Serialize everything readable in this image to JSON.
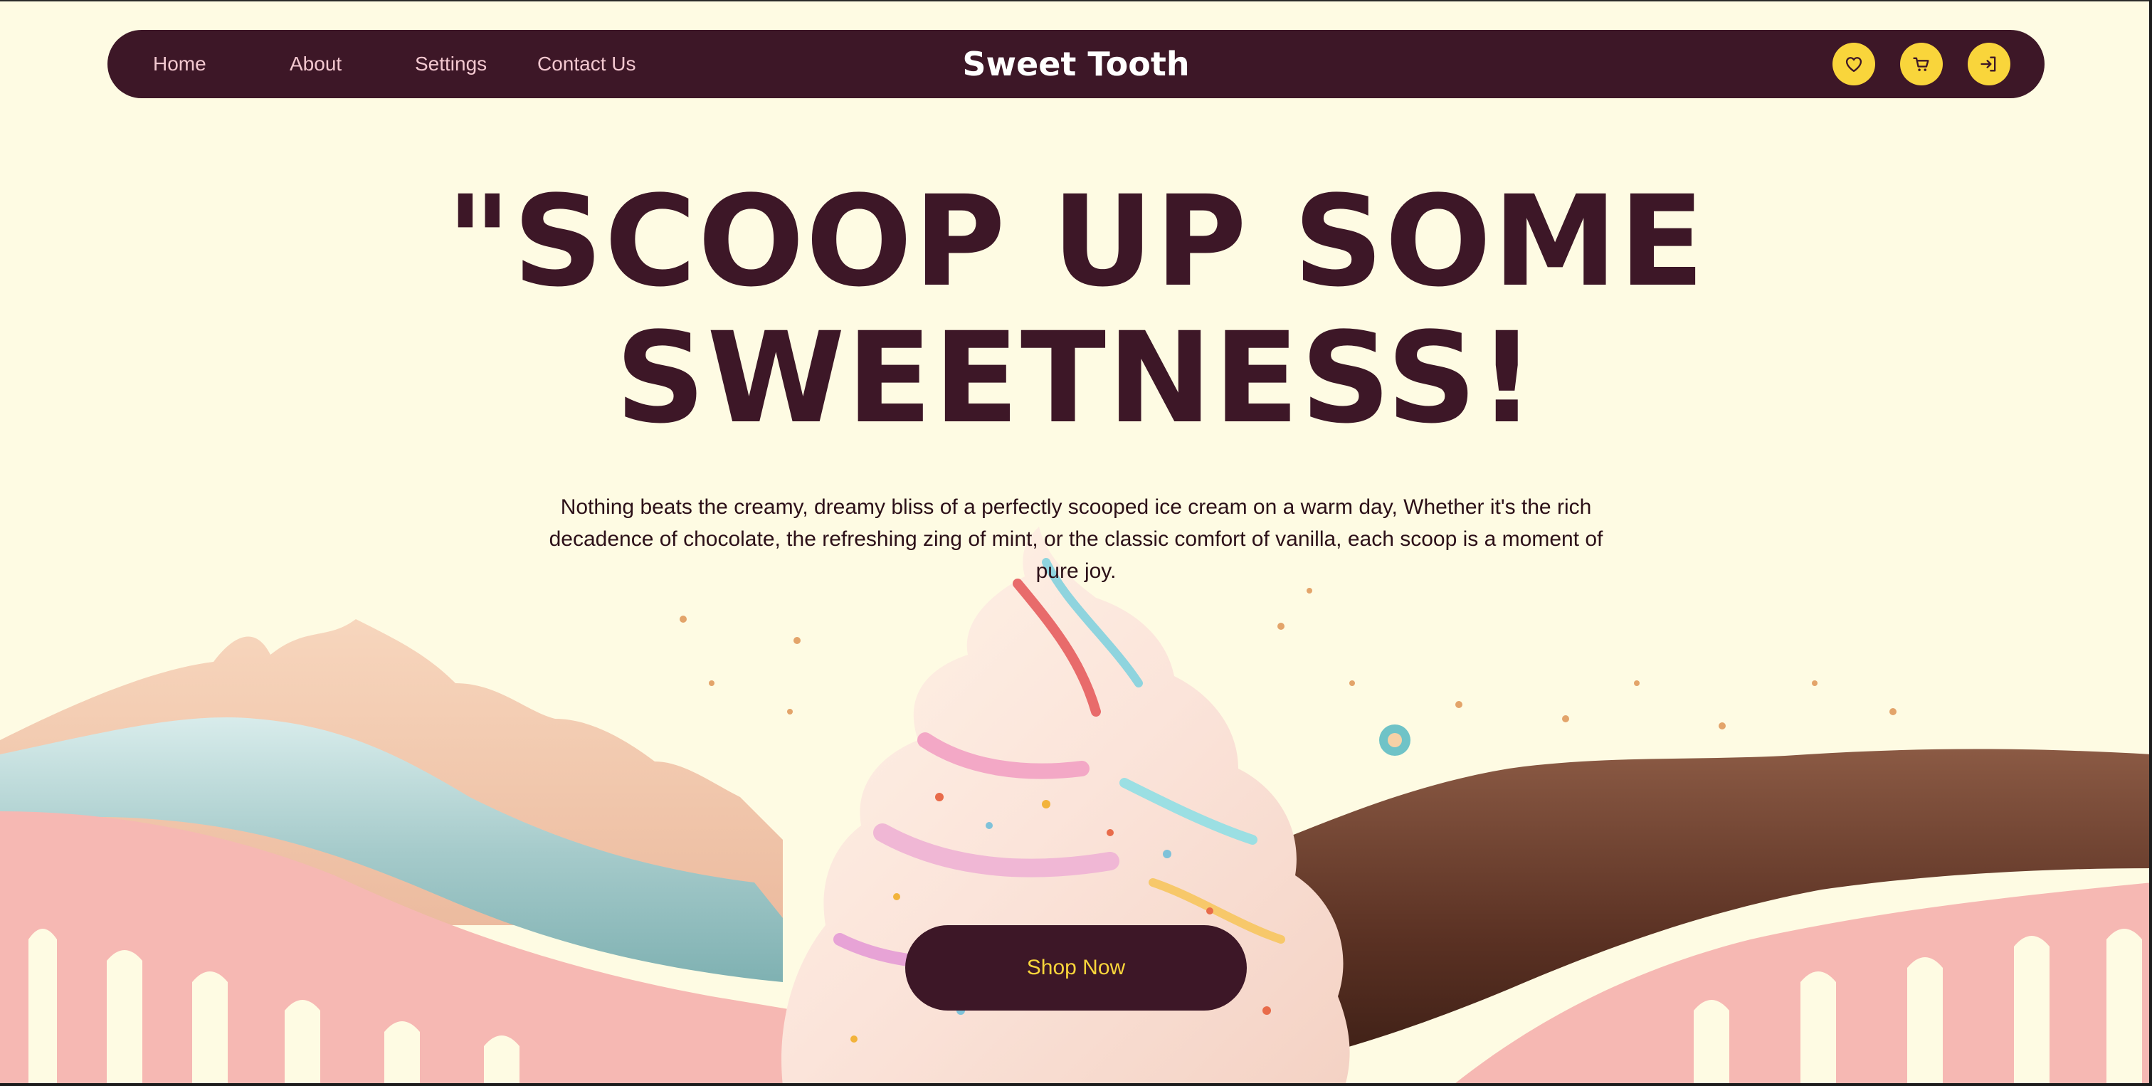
{
  "nav": {
    "links": [
      "Home",
      "About",
      "Settings",
      "Contact Us"
    ],
    "brand": "Sweet Tooth",
    "icons": [
      "heart-icon",
      "cart-icon",
      "sign-in-icon"
    ]
  },
  "hero": {
    "title_line1": "\"SCOOP UP SOME",
    "title_line2": "SWEETNESS!",
    "description": "Nothing beats the creamy, dreamy bliss of a perfectly scooped ice cream on a warm day, Whether it's the rich decadence of chocolate, the refreshing zing of mint, or the classic comfort of vanilla, each scoop is a moment of pure joy.",
    "cta_label": "Shop Now"
  },
  "colors": {
    "background": "#fefbe3",
    "nav_background": "#3d1727",
    "nav_link": "#f2c7cf",
    "accent_yellow": "#f9d53b",
    "title": "#3d1727",
    "pink_drip": "#f6b8b3",
    "mint_wave": "#a8cccb",
    "chocolate_wave": "#6b3f2e"
  }
}
